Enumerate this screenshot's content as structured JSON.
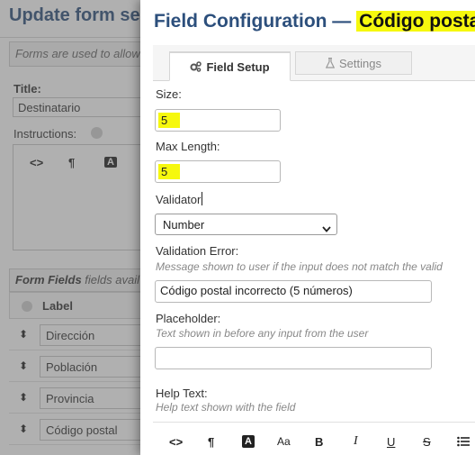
{
  "background": {
    "page_title": "Update form sec",
    "note": "Forms are used to allow",
    "title_label": "Title:",
    "title_value": "Destinatario",
    "instructions_label": "Instructions:",
    "editor_toolbar": [
      "<>",
      "¶",
      "A"
    ],
    "fields_heading_bold": "Form Fields",
    "fields_heading_rest": " fields avail",
    "table_header_label": "Label",
    "rows": [
      "Dirección",
      "Población",
      "Provincia",
      "Código postal"
    ]
  },
  "modal": {
    "title_prefix": "Field Configuration — ",
    "title_highlight": "Código postal",
    "tabs": [
      {
        "label": "Field Setup",
        "icon": "gears-icon",
        "active": true
      },
      {
        "label": "Settings",
        "icon": "flask-icon",
        "active": false
      }
    ],
    "size_label": "Size:",
    "size_value": "5",
    "max_length_label": "Max Length:",
    "max_length_value": "5",
    "validator_label": "Validator",
    "validator_selected": "Number",
    "validation_error_label": "Validation Error:",
    "validation_error_help": "Message shown to user if the input does not match the valid",
    "validation_error_value": "Código postal incorrecto (5 números)",
    "placeholder_label": "Placeholder:",
    "placeholder_help": "Text shown in before any input from the user",
    "placeholder_value": "",
    "help_text_label": "Help Text:",
    "help_text_help": "Help text shown with the field",
    "toolbar": [
      "<>",
      "¶",
      "A",
      "Aa",
      "B",
      "I",
      "U",
      "S",
      "list"
    ]
  },
  "colors": {
    "title_blue": "#2c4f7c",
    "highlight_yellow": "#f6f80e"
  }
}
